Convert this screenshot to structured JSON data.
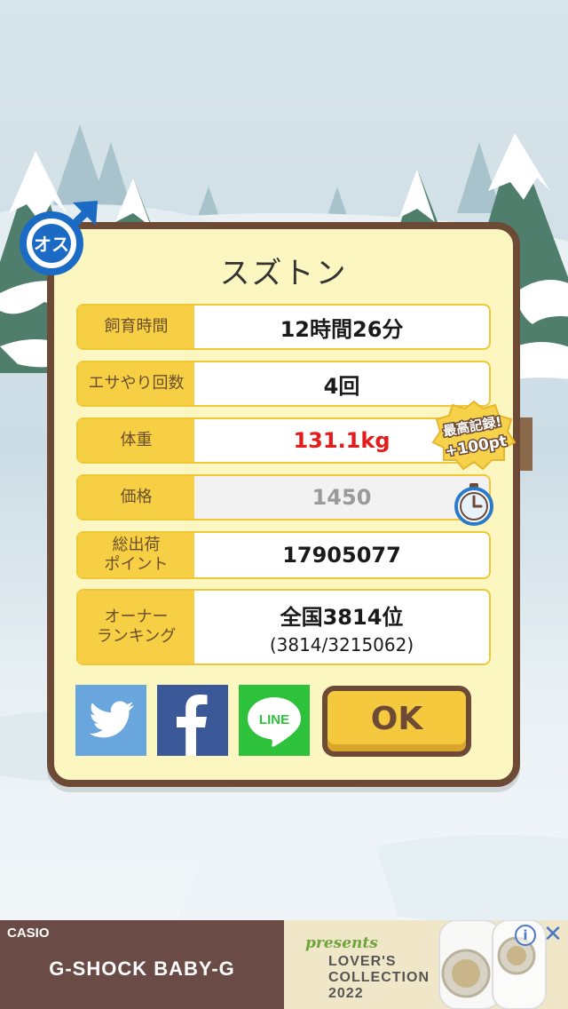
{
  "pet": {
    "name": "スズトン",
    "gender_label": "オス"
  },
  "stats": [
    {
      "label": "飼育時間",
      "value": "12時間26分"
    },
    {
      "label": "エサやり回数",
      "value": "4回"
    },
    {
      "label": "体重",
      "value": "131.1kg"
    },
    {
      "label": "価格",
      "value": "1450"
    },
    {
      "label_line1": "総出荷",
      "label_line2": "ポイント",
      "value": "17905077"
    },
    {
      "label_line1": "オーナー",
      "label_line2": "ランキング",
      "value": "全国3814位",
      "sub_value": "(3814/3215062)"
    }
  ],
  "record_badge": {
    "line1": "最高記録!",
    "line2": "+100pt"
  },
  "share": {
    "twitter_icon": "twitter-icon",
    "facebook_icon": "facebook-icon",
    "line_label": "LINE"
  },
  "ok_label": "OK",
  "ad": {
    "brand": "CASIO",
    "title": "G-SHOCK BABY-G",
    "presents": "presents",
    "collection_line1": "LOVER'S",
    "collection_line2": "COLLECTION",
    "collection_line3": "2022",
    "info_icon": "i",
    "close_icon": "✕"
  },
  "colors": {
    "panel_bg": "#fcf7c0",
    "panel_border": "#6c4a35",
    "label_bg": "#f7cf45",
    "weight_red": "#e31b1b",
    "twitter": "#6aa6de",
    "facebook": "#3b5999",
    "line": "#2ec13c"
  }
}
